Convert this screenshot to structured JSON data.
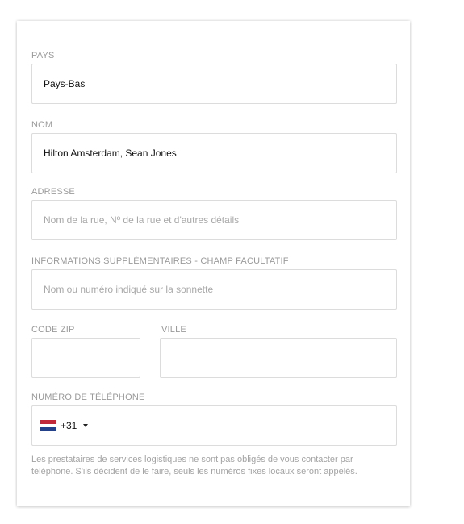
{
  "form": {
    "country": {
      "label": "PAYS",
      "value": "Pays-Bas"
    },
    "name": {
      "label": "NOM",
      "value": "Hilton Amsterdam, Sean Jones"
    },
    "address": {
      "label": "ADRESSE",
      "value": "",
      "placeholder": "Nom de la rue, Nº de la rue et d'autres détails"
    },
    "additional": {
      "label": "INFORMATIONS SUPPLÉMENTAIRES - CHAMP FACULTATIF",
      "value": "",
      "placeholder": "Nom ou numéro indiqué sur la sonnette"
    },
    "zip": {
      "label": "CODE ZIP",
      "value": ""
    },
    "city": {
      "label": "VILLE",
      "value": ""
    },
    "phone": {
      "label": "NUMÉRO DE TÉLÉPHONE",
      "flag_icon": "netherlands-flag-icon",
      "dial_code": "+31",
      "value": ""
    },
    "help_text": "Les prestataires de services logistiques ne sont pas obligés de vous contacter par téléphone. S'ils décident de le faire, seuls les numéros fixes locaux seront appelés."
  },
  "colors": {
    "label": "#9a9a9a",
    "border": "#dcdcdc",
    "flag_red": "#c0293a",
    "flag_white": "#ffffff",
    "flag_blue": "#23418b"
  }
}
